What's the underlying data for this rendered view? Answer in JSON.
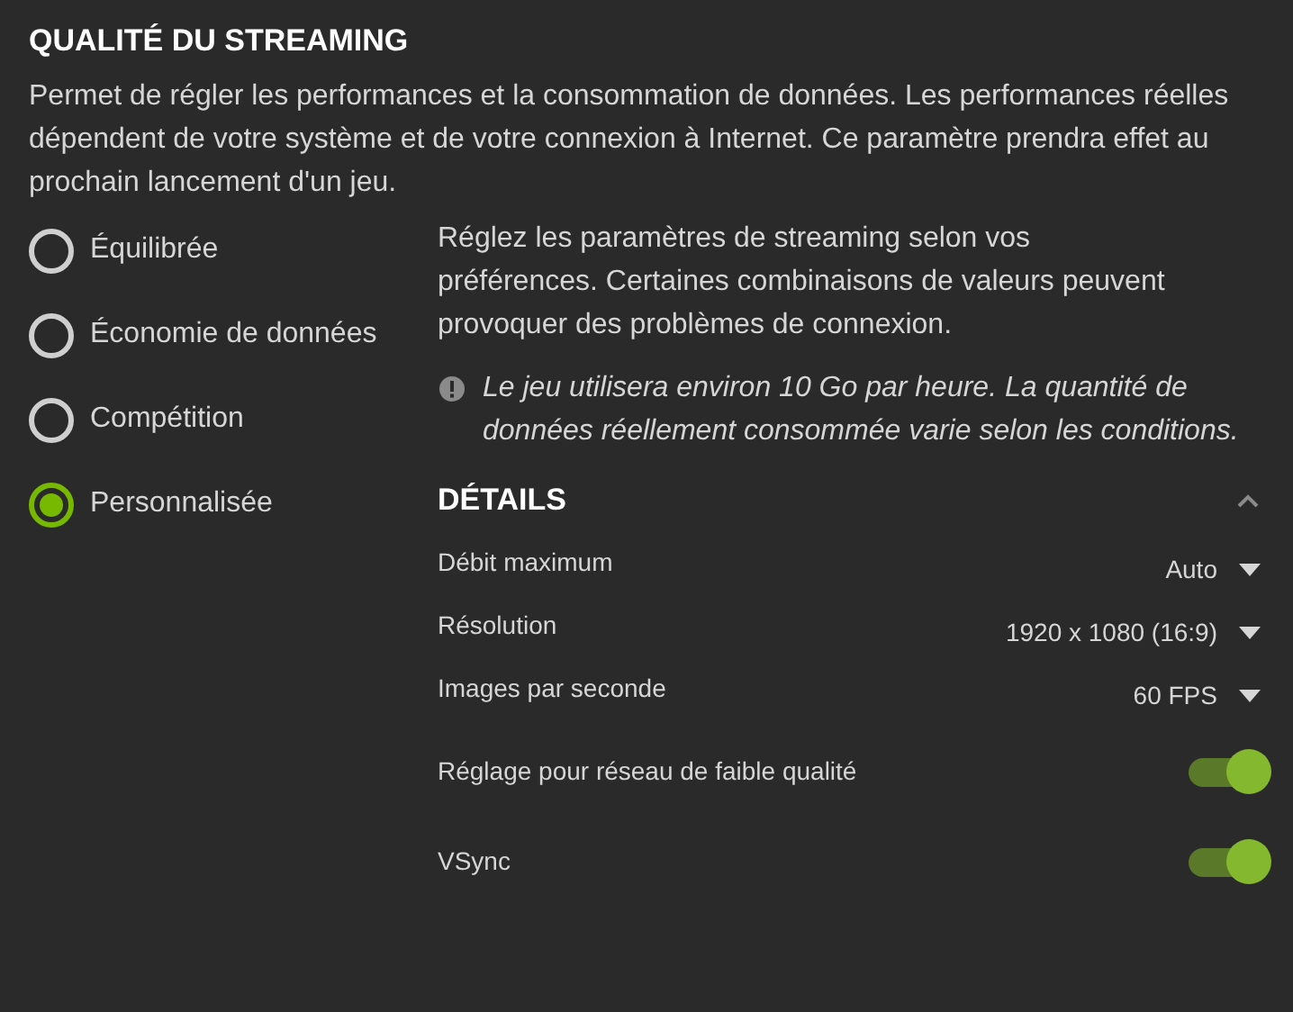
{
  "title": "QUALITÉ DU STREAMING",
  "description": "Permet de régler les performances et la consommation de données. Les performances réelles dépendent de votre système et de votre connexion à Internet. Ce paramètre prendra effet au prochain lancement d'un jeu.",
  "presets": [
    {
      "label": "Équilibrée",
      "selected": false
    },
    {
      "label": "Économie de données",
      "selected": false
    },
    {
      "label": "Compétition",
      "selected": false
    },
    {
      "label": "Personnalisée",
      "selected": true
    }
  ],
  "help_text": "Réglez les paramètres de streaming selon vos préférences. Certaines combinaisons de valeurs peuvent provoquer des problèmes de connexion.",
  "notice": "Le jeu utilisera environ 10 Go par heure. La quantité de données réellement consommée varie selon les conditions.",
  "details": {
    "title": "DÉTAILS",
    "expanded": true,
    "settings": [
      {
        "kind": "dropdown",
        "label": "Débit maximum",
        "value": "Auto"
      },
      {
        "kind": "dropdown",
        "label": "Résolution",
        "value": "1920 x 1080 (16:9)"
      },
      {
        "kind": "dropdown",
        "label": "Images par seconde",
        "value": "60 FPS"
      },
      {
        "kind": "toggle",
        "label": "Réglage pour réseau de faible qualité",
        "on": true
      },
      {
        "kind": "toggle",
        "label": "VSync",
        "on": true
      }
    ]
  }
}
